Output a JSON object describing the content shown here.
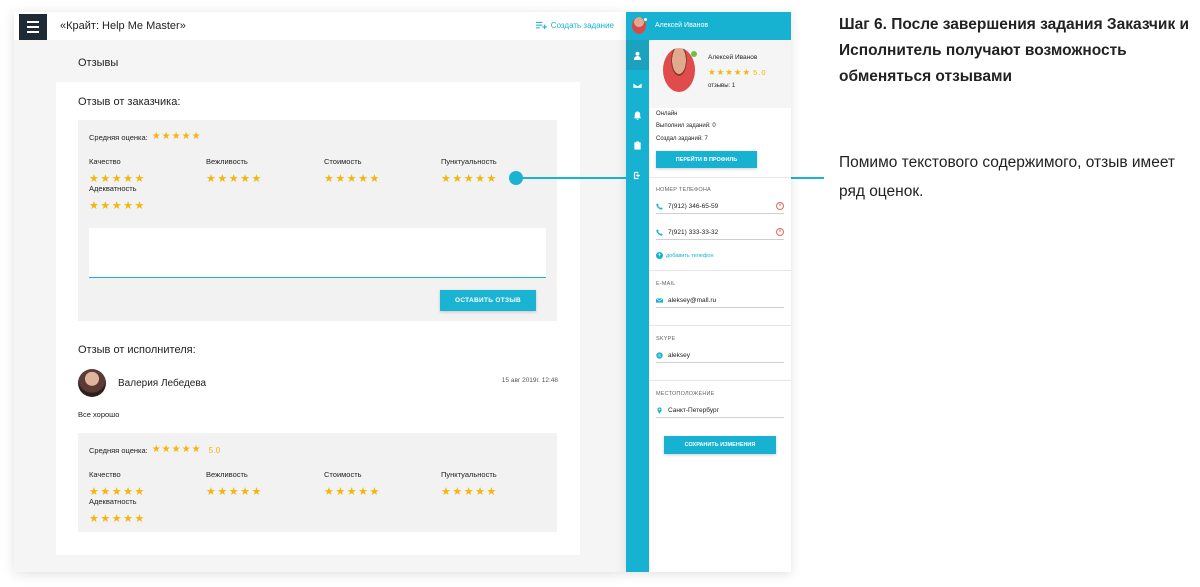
{
  "app": {
    "title": "«Крайт: Help Me Master»",
    "create_task": "Создать задание",
    "section_title": "Отзывы"
  },
  "customer_review": {
    "heading": "Отзыв от заказчика:",
    "avg_label": "Средняя оценка:",
    "avg_stars": "★★★★★",
    "criteria": [
      {
        "label": "Качество",
        "stars": "★★★★★"
      },
      {
        "label": "Вежливость",
        "stars": "★★★★★"
      },
      {
        "label": "Стоимость",
        "stars": "★★★★★"
      },
      {
        "label": "Пунктуальность",
        "stars": "★★★★★"
      },
      {
        "label": "Адекватность",
        "stars": "★★★★★"
      }
    ],
    "submit": "ОСТАВИТЬ ОТЗЫВ"
  },
  "executor_review": {
    "heading": "Отзыв от исполнителя:",
    "author": "Валерия Лебедева",
    "date": "15 авг 2019г. 12:48",
    "text": "Все хорошо",
    "avg_label": "Средняя оценка:",
    "avg_stars": "★★★★★",
    "avg_score": "5.0",
    "criteria": [
      {
        "label": "Качество",
        "stars": "★★★★★"
      },
      {
        "label": "Вежливость",
        "stars": "★★★★★"
      },
      {
        "label": "Стоимость",
        "stars": "★★★★★"
      },
      {
        "label": "Пунктуальность",
        "stars": "★★★★★"
      },
      {
        "label": "Адекватность",
        "stars": "★★★★★"
      }
    ]
  },
  "profile": {
    "header_name": "Алексей Иванов",
    "name": "Алексей Иванов",
    "stars": "★★★★★",
    "score": "5.0",
    "reviews": "отзывы: 1",
    "status": "Онлайн",
    "completed": "Выполнил заданий: 0",
    "created": "Создал заданий: 7",
    "go_profile": "ПЕРЕЙТИ В ПРОФИЛЬ",
    "phone_label": "НОМЕР ТЕЛЕФОНА",
    "phones": [
      "7(912) 346-65-59",
      "7(921) 333-33-32"
    ],
    "add_phone": "добавить телефон",
    "email_label": "E-MAIL",
    "email": "aleksey@mall.ru",
    "skype_label": "SKYPE",
    "skype": "aleksey",
    "location_label": "МЕСТОПОЛОЖЕНИЕ",
    "location": "Санкт-Петербург",
    "save": "СОХРАНИТЬ ИЗМЕНЕНИЯ",
    "remove_symbol": "×",
    "add_symbol": "+"
  },
  "description": {
    "title": "Шаг 6. После завершения задания Заказчик и Исполнитель получают возможность обменяться отзывами",
    "text": "Помимо текстового содержимого, отзыв имеет ряд оценок."
  },
  "colors": {
    "accent": "#1ab3d2",
    "star": "#f5b50a",
    "dark": "#1e2b36"
  }
}
